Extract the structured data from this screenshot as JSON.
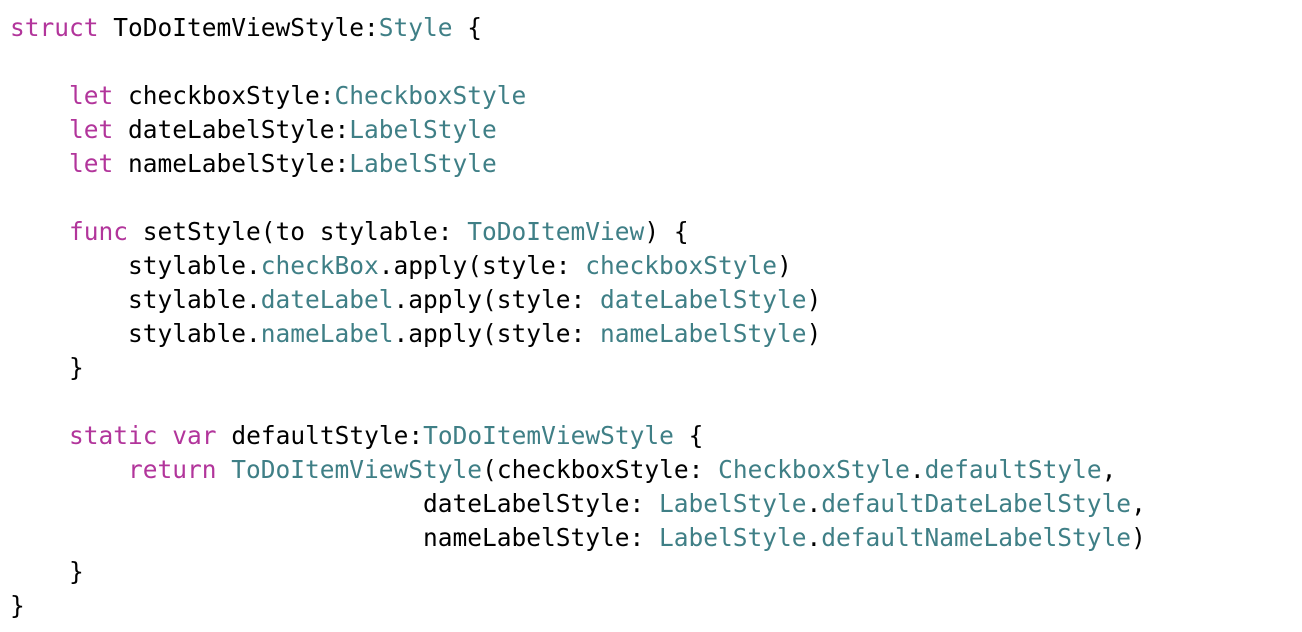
{
  "colors": {
    "keyword": "#B2359B",
    "type": "#3F7F86",
    "plain": "#000000"
  },
  "code_lines": [
    [
      [
        "struct",
        "k"
      ],
      [
        " ToDoItemViewStyle:",
        "p"
      ],
      [
        "Style",
        "t"
      ],
      [
        " {",
        "p"
      ]
    ],
    [],
    [
      [
        "    ",
        "p"
      ],
      [
        "let",
        "k"
      ],
      [
        " checkboxStyle:",
        "p"
      ],
      [
        "CheckboxStyle",
        "t"
      ]
    ],
    [
      [
        "    ",
        "p"
      ],
      [
        "let",
        "k"
      ],
      [
        " dateLabelStyle:",
        "p"
      ],
      [
        "LabelStyle",
        "t"
      ]
    ],
    [
      [
        "    ",
        "p"
      ],
      [
        "let",
        "k"
      ],
      [
        " nameLabelStyle:",
        "p"
      ],
      [
        "LabelStyle",
        "t"
      ]
    ],
    [],
    [
      [
        "    ",
        "p"
      ],
      [
        "func",
        "k"
      ],
      [
        " setStyle(to stylable: ",
        "p"
      ],
      [
        "ToDoItemView",
        "t"
      ],
      [
        ") {",
        "p"
      ]
    ],
    [
      [
        "        stylable.",
        "p"
      ],
      [
        "checkBox",
        "t"
      ],
      [
        ".apply(style: ",
        "p"
      ],
      [
        "checkboxStyle",
        "t"
      ],
      [
        ")",
        "p"
      ]
    ],
    [
      [
        "        stylable.",
        "p"
      ],
      [
        "dateLabel",
        "t"
      ],
      [
        ".apply(style: ",
        "p"
      ],
      [
        "dateLabelStyle",
        "t"
      ],
      [
        ")",
        "p"
      ]
    ],
    [
      [
        "        stylable.",
        "p"
      ],
      [
        "nameLabel",
        "t"
      ],
      [
        ".apply(style: ",
        "p"
      ],
      [
        "nameLabelStyle",
        "t"
      ],
      [
        ")",
        "p"
      ]
    ],
    [
      [
        "    }",
        "p"
      ]
    ],
    [],
    [
      [
        "    ",
        "p"
      ],
      [
        "static",
        "k"
      ],
      [
        " ",
        "p"
      ],
      [
        "var",
        "k"
      ],
      [
        " defaultStyle:",
        "p"
      ],
      [
        "ToDoItemViewStyle",
        "t"
      ],
      [
        " {",
        "p"
      ]
    ],
    [
      [
        "        ",
        "p"
      ],
      [
        "return",
        "k"
      ],
      [
        " ",
        "p"
      ],
      [
        "ToDoItemViewStyle",
        "t"
      ],
      [
        "(checkboxStyle: ",
        "p"
      ],
      [
        "CheckboxStyle",
        "t"
      ],
      [
        ".",
        "p"
      ],
      [
        "defaultStyle",
        "t"
      ],
      [
        ",",
        "p"
      ]
    ],
    [
      [
        "                            dateLabelStyle: ",
        "p"
      ],
      [
        "LabelStyle",
        "t"
      ],
      [
        ".",
        "p"
      ],
      [
        "defaultDateLabelStyle",
        "t"
      ],
      [
        ",",
        "p"
      ]
    ],
    [
      [
        "                            nameLabelStyle: ",
        "p"
      ],
      [
        "LabelStyle",
        "t"
      ],
      [
        ".",
        "p"
      ],
      [
        "defaultNameLabelStyle",
        "t"
      ],
      [
        ")",
        "p"
      ]
    ],
    [
      [
        "    }",
        "p"
      ]
    ],
    [
      [
        "}",
        "p"
      ]
    ]
  ]
}
